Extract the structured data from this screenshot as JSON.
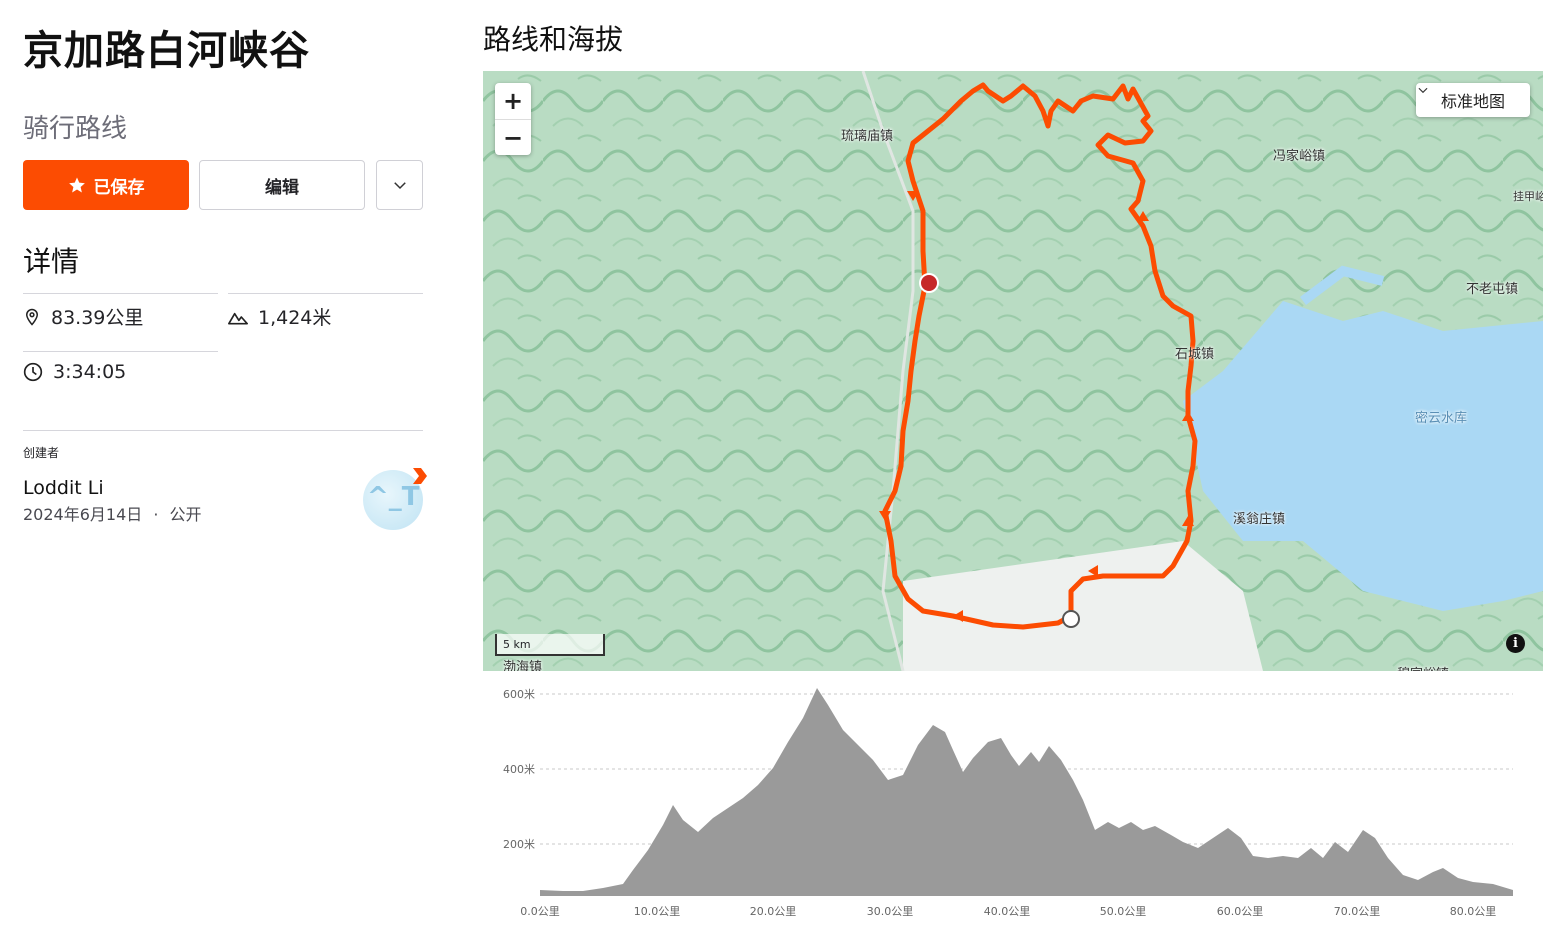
{
  "route": {
    "title": "京加路白河峡谷",
    "subtitle": "骑行路线"
  },
  "actions": {
    "saved_label": "已保存",
    "edit_label": "编辑",
    "accent_color": "#fc4c02"
  },
  "details": {
    "heading": "详情",
    "distance": "83.39公里",
    "elevation": "1,424米",
    "time": "3:34:05"
  },
  "creator": {
    "label": "创建者",
    "name": "Loddit Li",
    "date": "2024年6月14日",
    "separator": "·",
    "visibility": "公开",
    "avatar_text": "^_T"
  },
  "map_section": {
    "heading": "路线和海拔",
    "zoom_in": "+",
    "zoom_out": "−",
    "map_type": "标准地图",
    "scale_label": "5 km",
    "info_label": "i",
    "places": {
      "p1": "琉璃庙镇",
      "p2": "冯家峪镇",
      "p3": "挂甲峪",
      "p4": "不老屯镇",
      "p5": "石城镇",
      "p6": "密云水库",
      "p7": "溪翁庄镇",
      "p8": "渤海镇",
      "p9": "穆家峪镇"
    },
    "route_color": "#fc4c02",
    "water_color": "#aad8f4"
  },
  "elevation_profile": {
    "ylabels": [
      "600米",
      "400米",
      "200米"
    ],
    "xlabels": [
      "0.0公里",
      "10.0公里",
      "20.0公里",
      "30.0公里",
      "40.0公里",
      "50.0公里",
      "60.0公里",
      "70.0公里",
      "80.0公里"
    ],
    "fill_color": "#9a9a9a"
  }
}
